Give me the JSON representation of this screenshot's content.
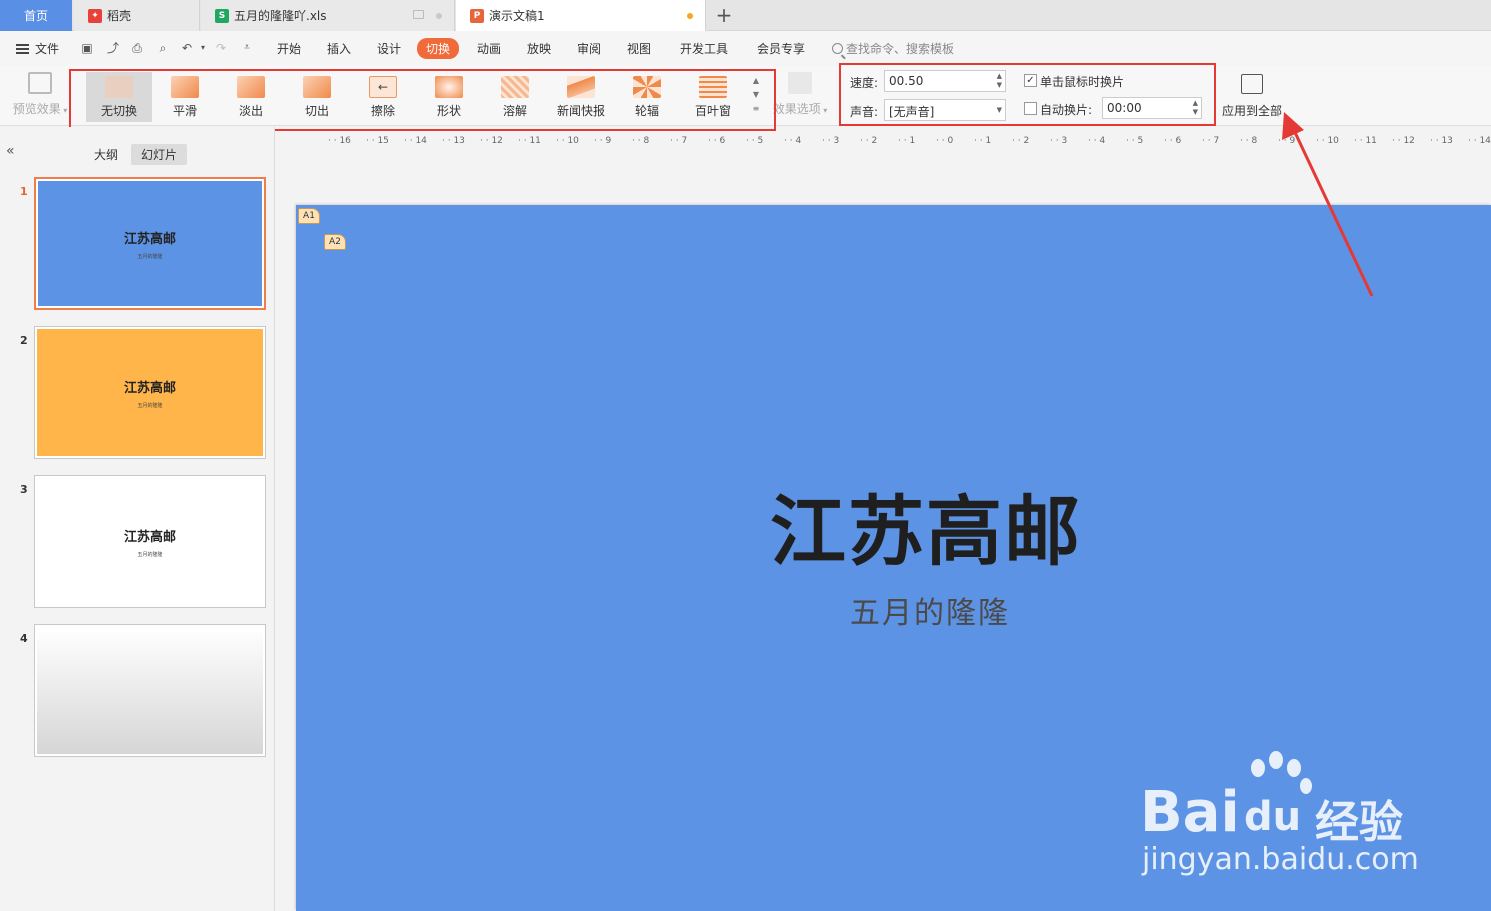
{
  "tabs": {
    "home": "首页",
    "items": [
      {
        "label": "稻壳",
        "icon": "docer-icon",
        "color": "#e8403a"
      },
      {
        "label": "五月的隆隆吖.xls",
        "icon": "spreadsheet-icon",
        "color": "#20a862"
      },
      {
        "label": "演示文稿1",
        "icon": "presentation-icon",
        "color": "#e8643a"
      }
    ]
  },
  "menu": {
    "file": "文件",
    "items": [
      "开始",
      "插入",
      "设计",
      "切换",
      "动画",
      "放映",
      "审阅",
      "视图",
      "开发工具",
      "会员专享"
    ],
    "active": "切换",
    "search_placeholder": "查找命令、搜索模板"
  },
  "ribbon": {
    "preview": "预览效果",
    "transitions": [
      "无切换",
      "平滑",
      "淡出",
      "切出",
      "擦除",
      "形状",
      "溶解",
      "新闻快报",
      "轮辐",
      "百叶窗"
    ],
    "selected_transition": "无切换",
    "effect_options": "效果选项",
    "speed_label": "速度:",
    "speed_value": "00.50",
    "sound_label": "声音:",
    "sound_value": "[无声音]",
    "on_click_label": "单击鼠标时换片",
    "on_click_checked": true,
    "auto_label": "自动换片:",
    "auto_checked": false,
    "auto_value": "00:00",
    "apply_all": "应用到全部"
  },
  "panel": {
    "tab_outline": "大纲",
    "tab_slides": "幻灯片",
    "slides": [
      {
        "num": "1",
        "title": "江苏高邮",
        "subtitle": "五月的隆隆",
        "bg": "#5d93e4"
      },
      {
        "num": "2",
        "title": "江苏高邮",
        "subtitle": "五月的隆隆",
        "bg": "#ffb54a"
      },
      {
        "num": "3",
        "title": "江苏高邮",
        "subtitle": "五月的隆隆",
        "bg": "#ffffff"
      },
      {
        "num": "4",
        "title": "",
        "subtitle": "",
        "bg": "gradient"
      }
    ]
  },
  "ruler": [
    "16",
    "15",
    "14",
    "13",
    "12",
    "11",
    "10",
    "9",
    "8",
    "7",
    "6",
    "5",
    "4",
    "3",
    "2",
    "1",
    "0",
    "1",
    "2",
    "3",
    "4",
    "5",
    "6",
    "7",
    "8",
    "9",
    "10",
    "11",
    "12",
    "13",
    "14"
  ],
  "canvas": {
    "title": "江苏高邮",
    "subtitle": "五月的隆隆",
    "badge1": "A1",
    "badge2": "A2",
    "bg": "#5d93e4"
  },
  "watermark": {
    "brand_latin": "Bai",
    "brand_du": "du",
    "brand_cn": "经验",
    "url": "jingyan.baidu.com"
  }
}
